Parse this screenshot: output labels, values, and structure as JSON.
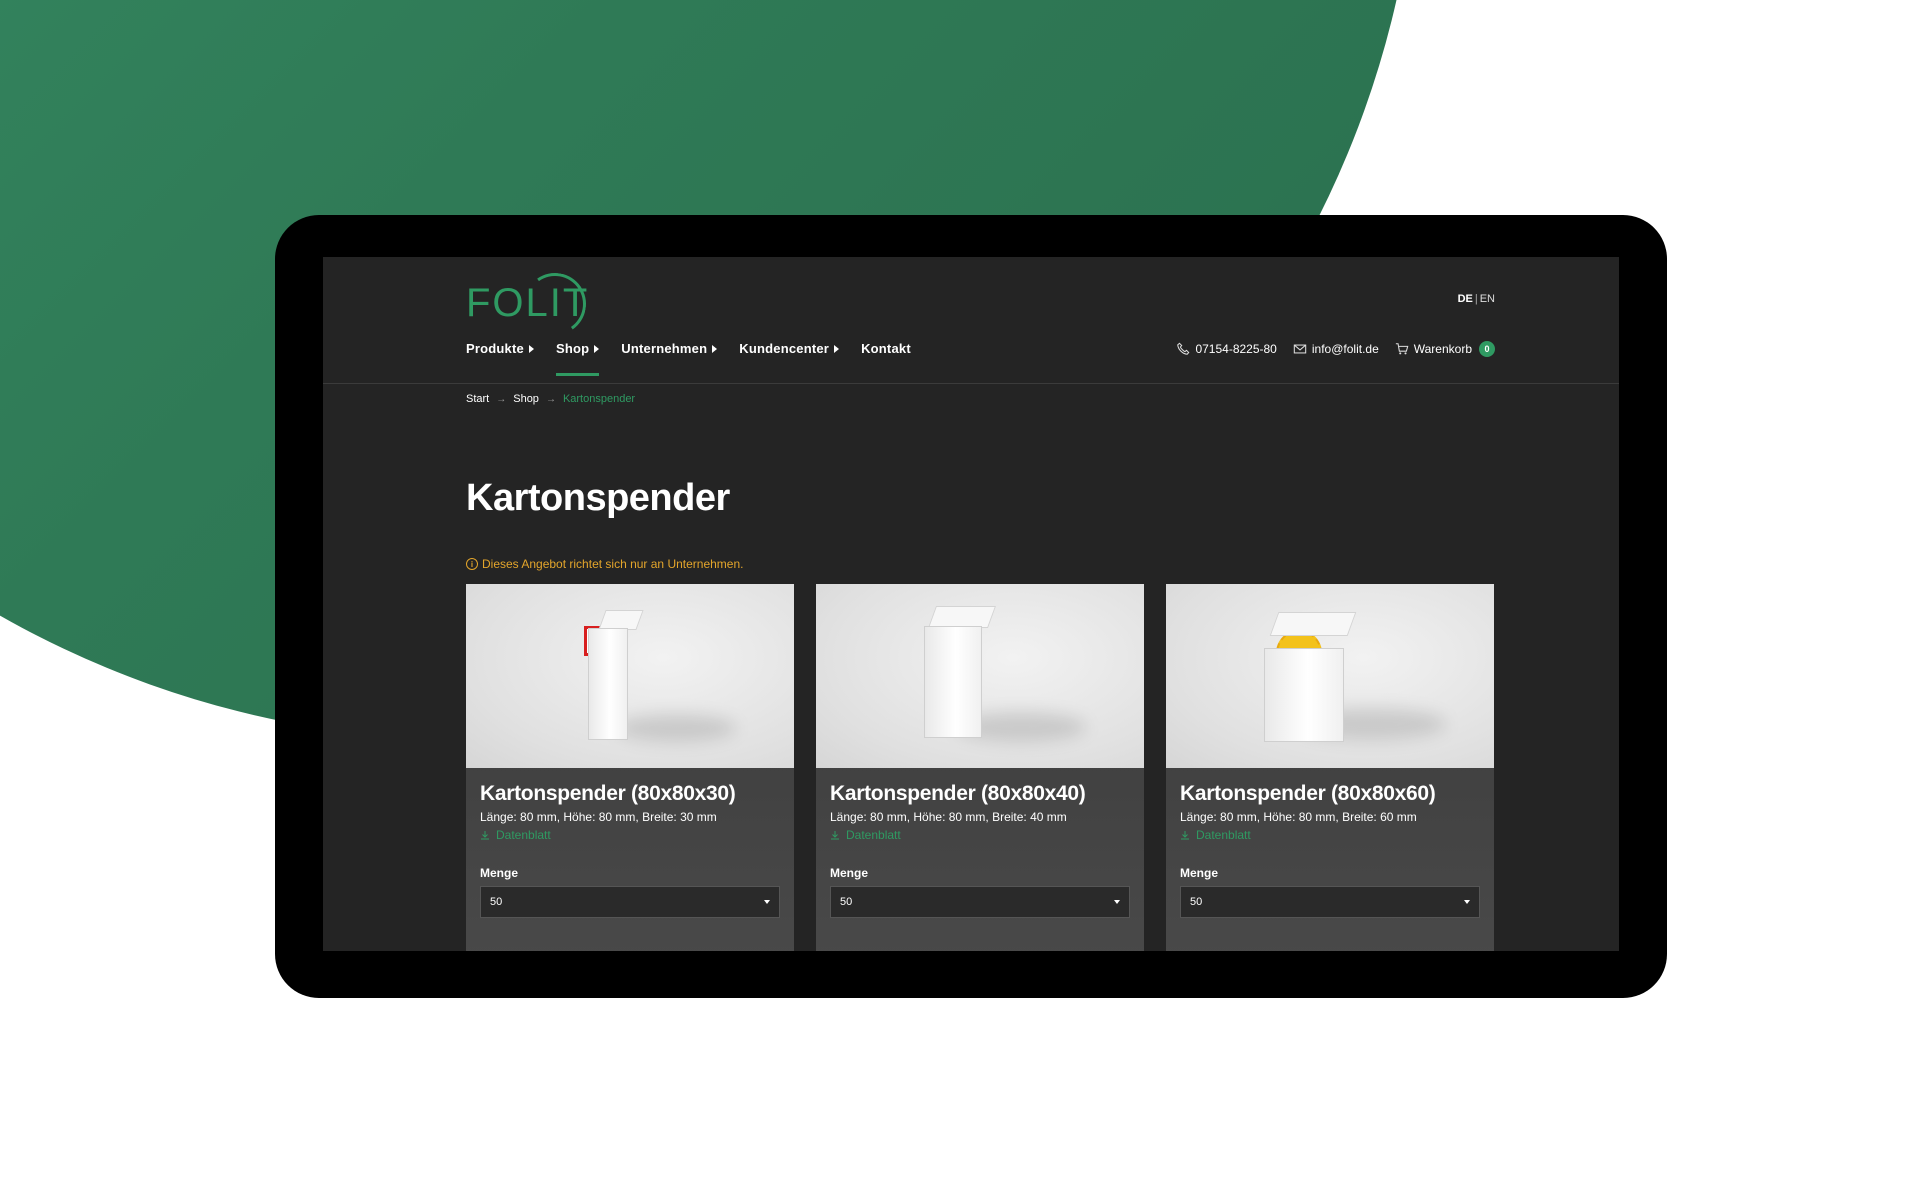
{
  "brand": {
    "logo_text": "FOLIT",
    "accent_color": "#2f9a62",
    "warning_color": "#e3a52b"
  },
  "lang": {
    "active": "DE",
    "separator": "|",
    "other": "EN"
  },
  "nav": {
    "items": [
      {
        "label": "Produkte",
        "has_submenu": true
      },
      {
        "label": "Shop",
        "has_submenu": true,
        "active": true
      },
      {
        "label": "Unternehmen",
        "has_submenu": true
      },
      {
        "label": "Kundencenter",
        "has_submenu": true
      },
      {
        "label": "Kontakt",
        "has_submenu": false
      }
    ]
  },
  "contact": {
    "phone": "07154-8225-80",
    "email": "info@folit.de",
    "cart_label": "Warenkorb",
    "cart_count": "0"
  },
  "breadcrumb": {
    "items": [
      "Start",
      "Shop",
      "Kartonspender"
    ],
    "separator": "→"
  },
  "page": {
    "title": "Kartonspender",
    "notice_icon": "i",
    "notice": "Dieses Angebot richtet sich nur an Unternehmen."
  },
  "products": [
    {
      "title": "Kartonspender (80x80x30)",
      "dims": "Länge: 80 mm, Höhe: 80 mm, Breite: 30 mm",
      "datasheet": "Datenblatt",
      "qty_label": "Menge",
      "qty_value": "50"
    },
    {
      "title": "Kartonspender (80x80x40)",
      "dims": "Länge: 80 mm, Höhe: 80 mm, Breite: 40 mm",
      "datasheet": "Datenblatt",
      "qty_label": "Menge",
      "qty_value": "50"
    },
    {
      "title": "Kartonspender (80x80x60)",
      "dims": "Länge: 80 mm, Höhe: 80 mm, Breite: 60 mm",
      "datasheet": "Datenblatt",
      "qty_label": "Menge",
      "qty_value": "50"
    }
  ]
}
